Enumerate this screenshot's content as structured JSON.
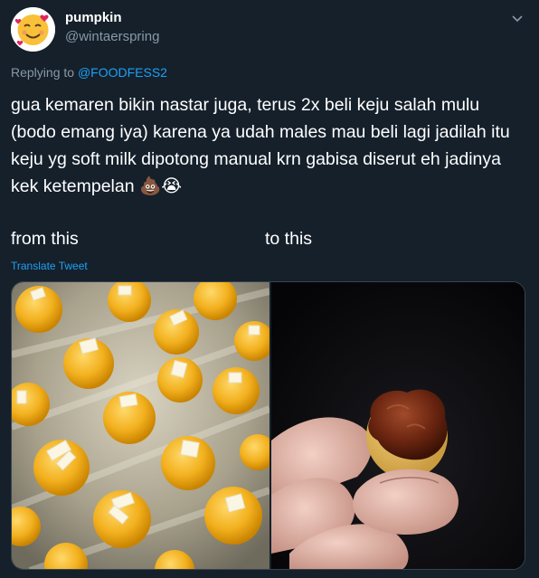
{
  "author": {
    "display_name": "pumpkin",
    "handle": "@wintaerspring",
    "avatar_icon": "smiling-face-with-hearts-emoji-icon"
  },
  "reply": {
    "prefix": "Replying to",
    "mention": "@FOODFESS2"
  },
  "tweet": {
    "text": "gua kemaren bikin nastar juga, terus 2x beli keju salah mulu (bodo emang iya) karena ya udah males mau beli lagi jadilah itu keju yg soft milk dipotong manual krn gabisa diserut eh jadinya kek ketempelan 💩😭",
    "label_left": "from this",
    "label_right": "to this",
    "translate": "Translate Tweet"
  },
  "media": {
    "left_photo": "nastar-cookies-with-cheese-tray-photo",
    "right_photo": "burnt-nastar-in-hand-photo"
  },
  "colors": {
    "background": "#15202b",
    "secondary_text": "#8899a6",
    "link": "#1da1f2",
    "border": "#38444d"
  }
}
